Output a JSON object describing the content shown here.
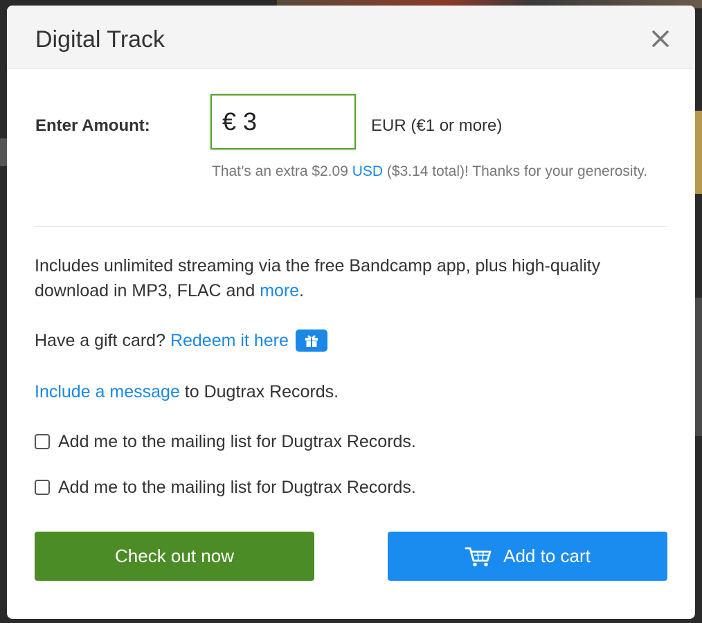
{
  "modal": {
    "title": "Digital Track"
  },
  "amount": {
    "label": "Enter Amount:",
    "currency_symbol": "€",
    "value": "3",
    "currency_hint": "EUR (€1 or more)",
    "note_prefix": "That’s an extra $2.09 ",
    "note_link": "USD",
    "note_suffix": " ($3.14 total)! Thanks for your generosity."
  },
  "includes": {
    "text": "Includes unlimited streaming via the free Bandcamp app, plus high-quality download in MP3, FLAC and ",
    "link": "more",
    "suffix": "."
  },
  "giftcard": {
    "prefix": "Have a gift card? ",
    "link": "Redeem it here"
  },
  "message": {
    "link": "Include a message",
    "suffix": " to Dugtrax Records."
  },
  "mailing": [
    {
      "label": "Add me to the mailing list for Dugtrax Records."
    },
    {
      "label": "Add me to the mailing list for Dugtrax Records."
    }
  ],
  "buttons": {
    "checkout": "Check out now",
    "add_to_cart": "Add to cart"
  },
  "colors": {
    "link": "#1c88e5",
    "checkout_bg": "#4c8c26",
    "cart_bg": "#1a8bef",
    "input_border": "#5aa02c"
  },
  "icons": {
    "close": "close-icon",
    "gift": "gift-icon",
    "cart": "cart-icon"
  }
}
